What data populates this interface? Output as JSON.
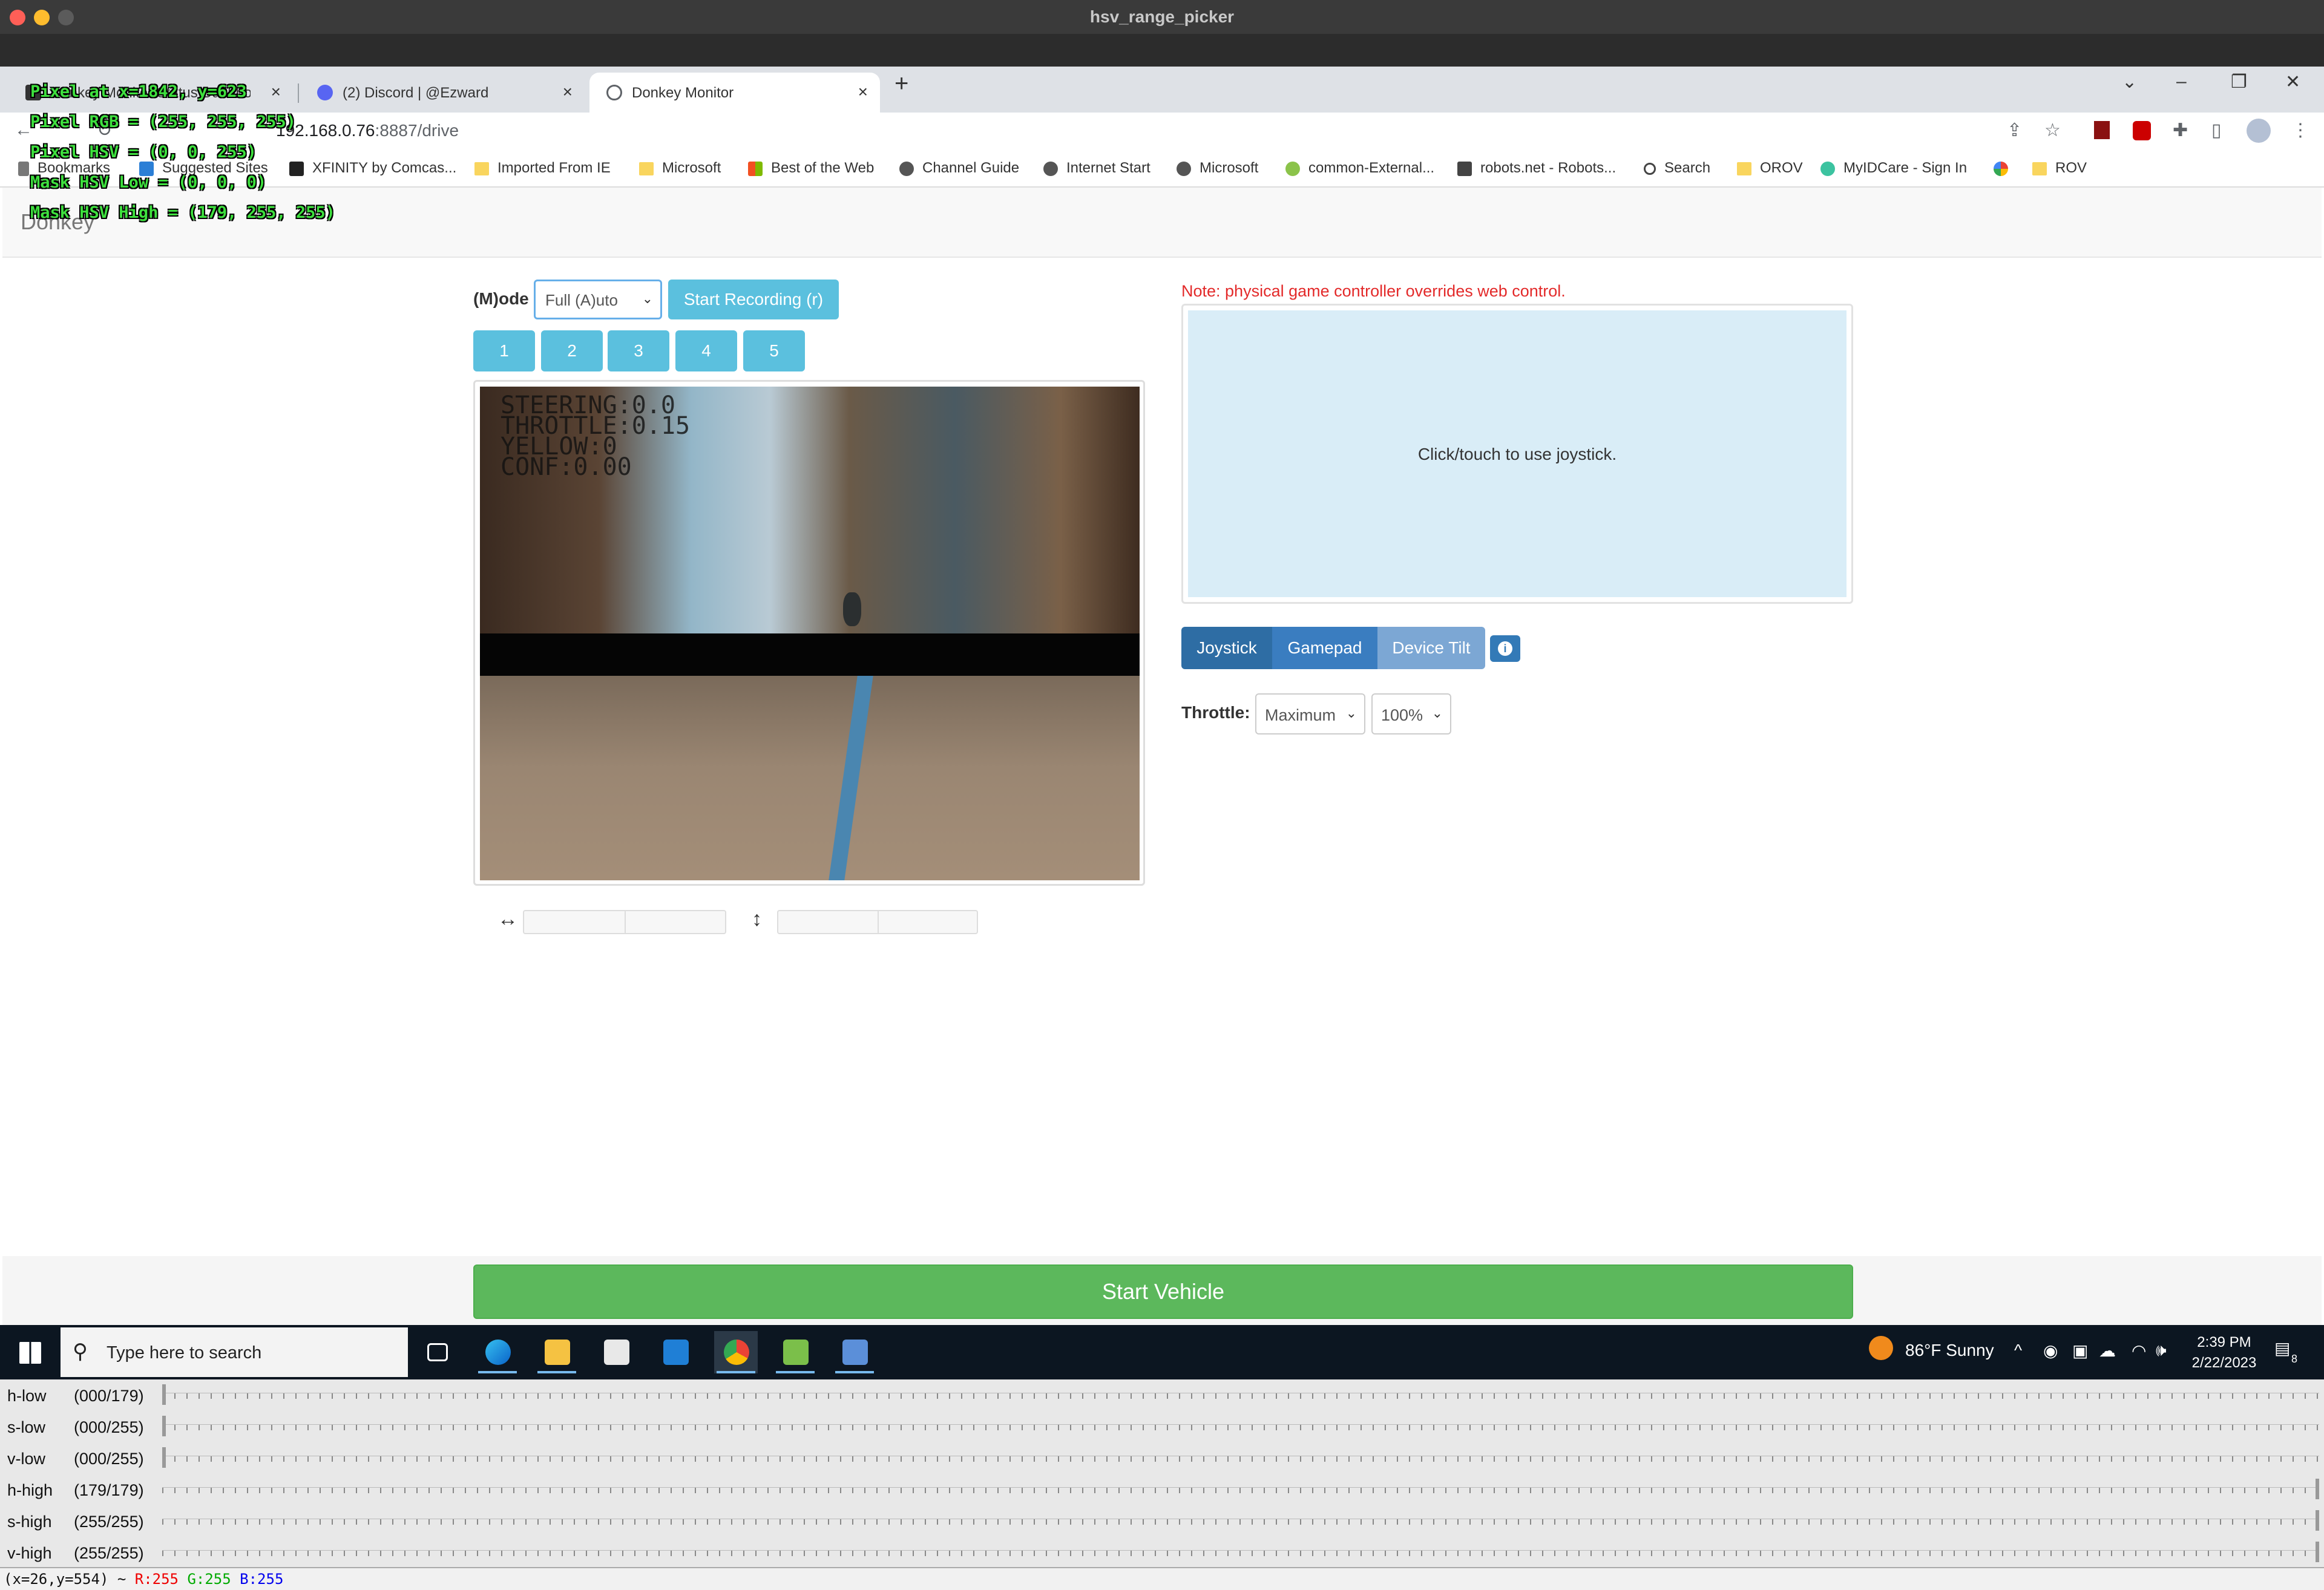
{
  "window": {
    "title": "hsv_range_picker"
  },
  "browser": {
    "tabs": [
      {
        "label": "Donkey Monitor Status Dashbo",
        "active": false
      },
      {
        "label": "(2) Discord | @Ezward",
        "active": false
      },
      {
        "label": "Donkey Monitor",
        "active": true
      }
    ],
    "url_host": "192.168.0.76",
    "url_path": ":8887/drive",
    "bookmarks": [
      "Bookmarks",
      "Suggested Sites",
      "XFINITY by Comcas...",
      "Imported From IE",
      "Microsoft",
      "Best of the Web",
      "Channel Guide",
      "Internet Start",
      "Microsoft",
      "common-External...",
      "robots.net - Robots...",
      "Search",
      "OROV",
      "MyIDCare - Sign In",
      "",
      "ROV"
    ]
  },
  "page": {
    "brand": "Donkey",
    "mode_label": "(M)ode",
    "mode_value": "Full (A)uto",
    "record_button": "Start Recording (r)",
    "number_buttons": [
      "1",
      "2",
      "3",
      "4",
      "5"
    ],
    "video_overlay": [
      "STEERING:0.0",
      "THROTTLE:0.15",
      "YELLOW:0",
      "CONF:0.00"
    ],
    "note": "Note: physical game controller overrides web control.",
    "joystick_hint": "Click/touch to use joystick.",
    "control_tabs": [
      {
        "label": "Joystick",
        "color": "#337ab7"
      },
      {
        "label": "Gamepad",
        "color": "#3f7fbf"
      },
      {
        "label": "Device Tilt",
        "color": "#7ca7d4"
      }
    ],
    "info_glyph": "i",
    "throttle_label": "Throttle:",
    "throttle_mode": "Maximum",
    "throttle_pct": "100%",
    "start_vehicle": "Start Vehicle"
  },
  "hsv_overlay": [
    "Pixel at x=1842, y=623",
    "Pixel RGB = (255, 255, 255)",
    "Pixel HSV = (0, 0, 255)",
    "Mask HSV Low = (0, 0, 0)",
    "Mask HSV High = (179, 255, 255)"
  ],
  "taskbar": {
    "search_placeholder": "Type here to search",
    "weather": "86°F  Sunny",
    "time": "2:39 PM",
    "date": "2/22/2023",
    "notification_count": "8"
  },
  "trackbars": [
    {
      "name": "h-low",
      "value": "(000/179)",
      "fraction": 0.0
    },
    {
      "name": "s-low",
      "value": "(000/255)",
      "fraction": 0.0
    },
    {
      "name": "v-low",
      "value": "(000/255)",
      "fraction": 0.0
    },
    {
      "name": "h-high",
      "value": "(179/179)",
      "fraction": 1.0
    },
    {
      "name": "s-high",
      "value": "(255/255)",
      "fraction": 1.0
    },
    {
      "name": "v-high",
      "value": "(255/255)",
      "fraction": 1.0
    }
  ],
  "statusbar": {
    "coords": "(x=26,y=554) ~",
    "r": "R:255",
    "g": "G:255",
    "b": "B:255"
  },
  "colors": {
    "accent_info": "#5bc0de",
    "start_green": "#5cb85c",
    "note_red": "#e32a2a",
    "overlay_green": "#3ee03e"
  }
}
